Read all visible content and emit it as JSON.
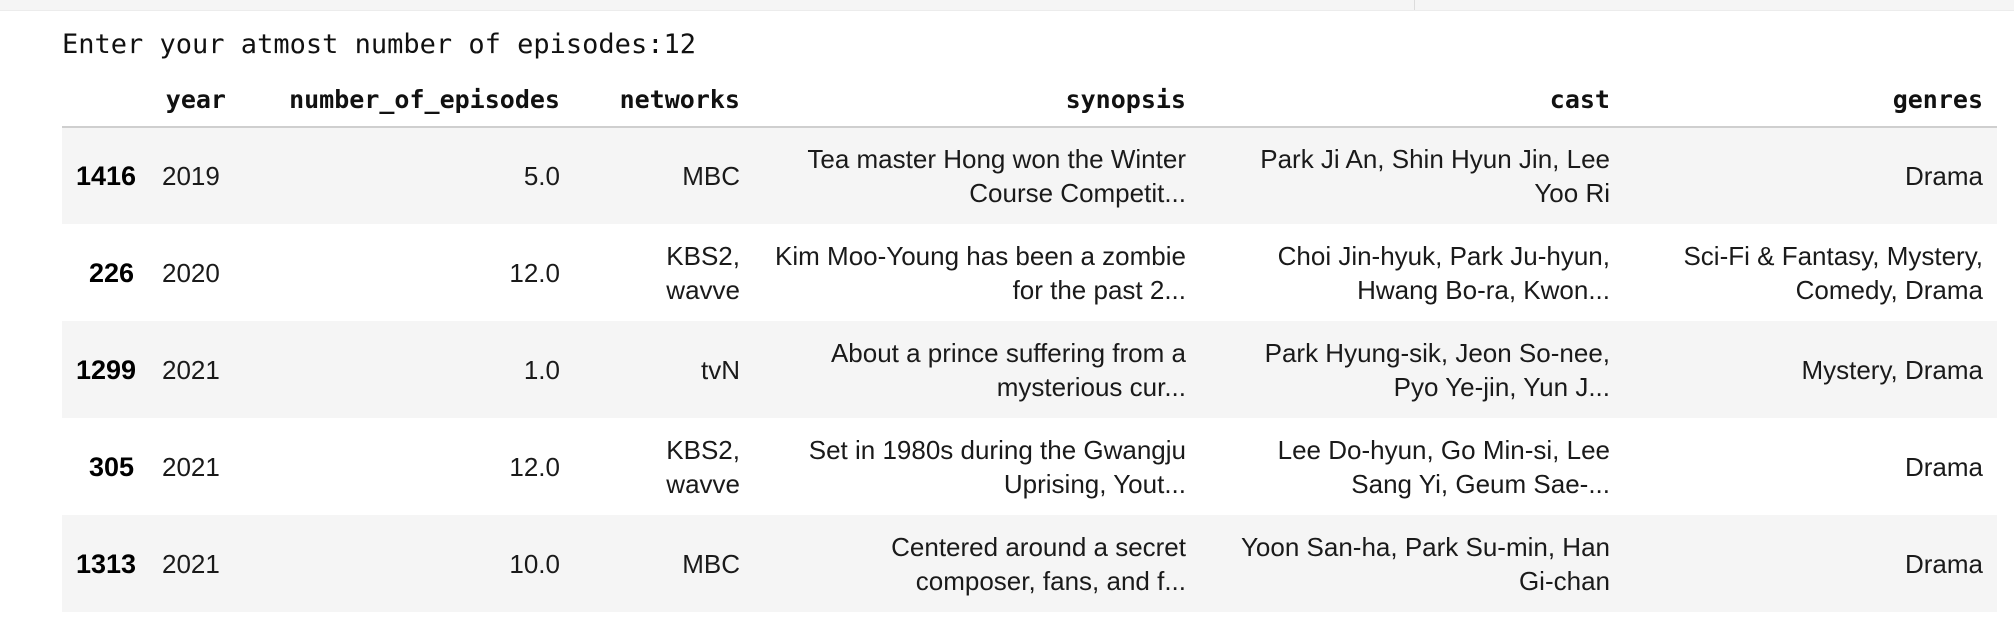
{
  "prompt": "Enter your atmost number of episodes:12",
  "columns": [
    "",
    "year",
    "number_of_episodes",
    "networks",
    "synopsis",
    "cast",
    "genres"
  ],
  "rows": [
    {
      "index": "1416",
      "year": "2019",
      "number_of_episodes": "5.0",
      "networks": "MBC",
      "synopsis": "Tea master Hong won the Winter Course Competit...",
      "cast": "Park Ji An, Shin Hyun Jin, Lee Yoo Ri",
      "genres": "Drama"
    },
    {
      "index": "226",
      "year": "2020",
      "number_of_episodes": "12.0",
      "networks": "KBS2, wavve",
      "synopsis": "Kim Moo-Young has been a zombie for the past 2...",
      "cast": "Choi Jin-hyuk, Park Ju-hyun, Hwang Bo-ra, Kwon...",
      "genres": "Sci-Fi & Fantasy, Mystery, Comedy, Drama"
    },
    {
      "index": "1299",
      "year": "2021",
      "number_of_episodes": "1.0",
      "networks": "tvN",
      "synopsis": "About a prince suffering from a mysterious cur...",
      "cast": "Park Hyung-sik, Jeon So-nee, Pyo Ye-jin, Yun J...",
      "genres": "Mystery, Drama"
    },
    {
      "index": "305",
      "year": "2021",
      "number_of_episodes": "12.0",
      "networks": "KBS2, wavve",
      "synopsis": "Set in 1980s during the Gwangju Uprising, Yout...",
      "cast": "Lee Do-hyun, Go Min-si, Lee Sang Yi, Geum Sae-...",
      "genres": "Drama"
    },
    {
      "index": "1313",
      "year": "2021",
      "number_of_episodes": "10.0",
      "networks": "MBC",
      "synopsis": "Centered around a secret composer, fans, and f...",
      "cast": "Yoon San-ha, Park Su-min, Han Gi-chan",
      "genres": "Drama"
    }
  ]
}
